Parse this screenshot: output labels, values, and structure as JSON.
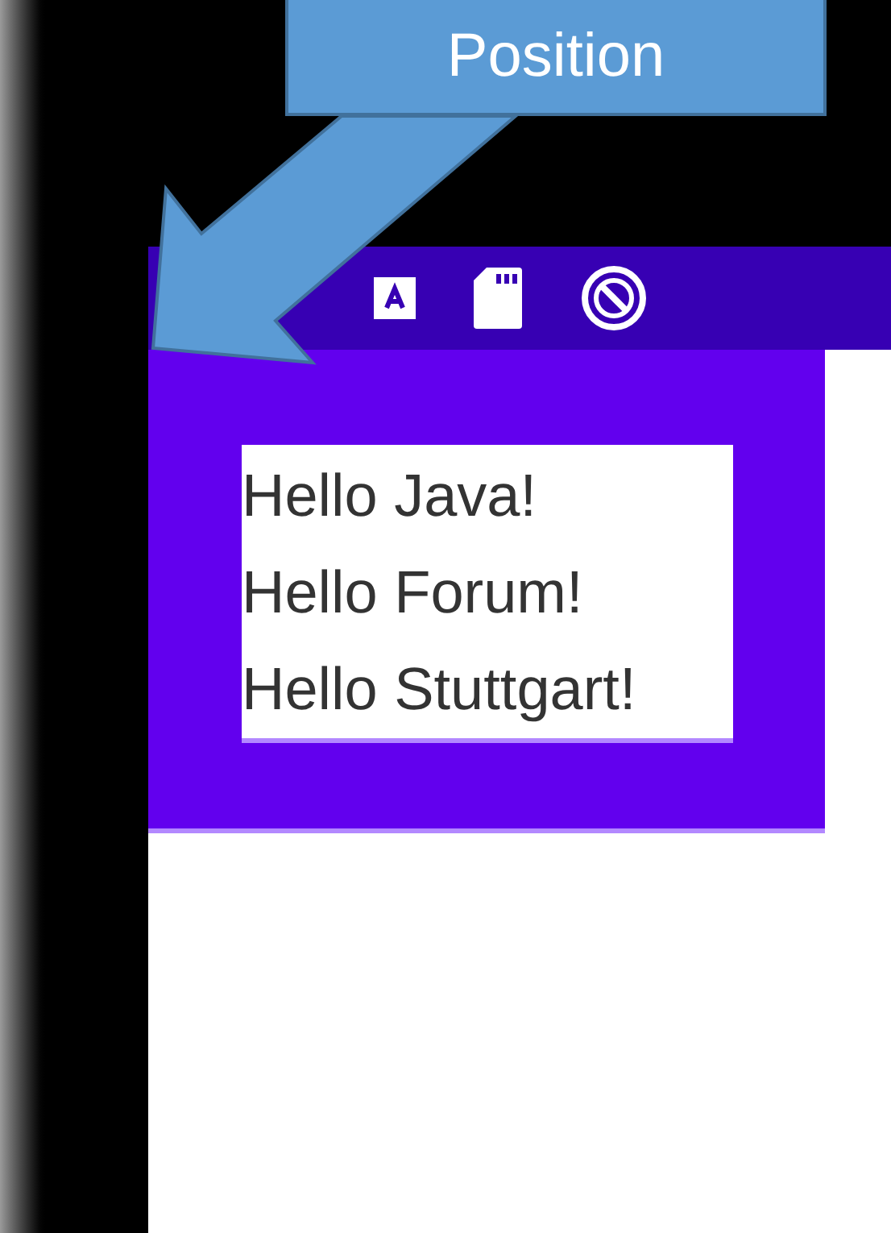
{
  "callout": {
    "text": "Position"
  },
  "app": {
    "lines": [
      "Hello Java!",
      "Hello Forum!",
      "Hello Stuttgart!"
    ]
  }
}
